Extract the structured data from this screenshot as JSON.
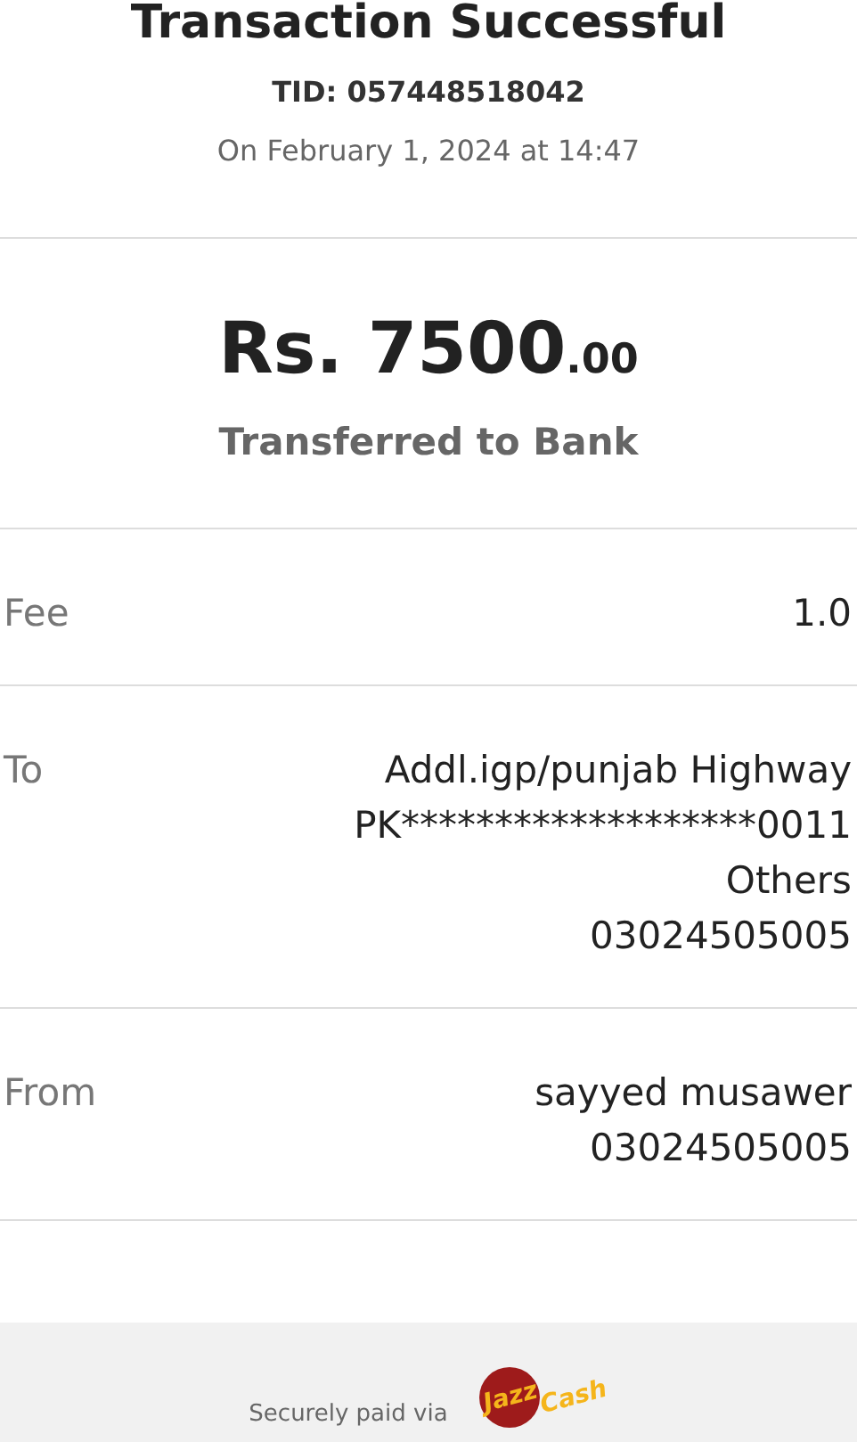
{
  "header": {
    "title": "Transaction Successful",
    "tid": "TID: 057448518042",
    "date": "On February 1, 2024 at 14:47"
  },
  "amount": {
    "main": "Rs. 7500",
    "decimals": ".00",
    "description": "Transferred to Bank"
  },
  "details": [
    {
      "label": "Fee",
      "lines": [
        "1.0"
      ]
    },
    {
      "label": "To",
      "lines": [
        "Addl.igp/punjab Highway",
        "PK*******************0011",
        "Others",
        "03024505005"
      ]
    },
    {
      "label": "From",
      "lines": [
        "sayyed musawer",
        "03024505005"
      ]
    }
  ],
  "footer": {
    "text": "Securely paid via",
    "logo_part_1": "Jazz",
    "logo_part_2": "Cash"
  }
}
